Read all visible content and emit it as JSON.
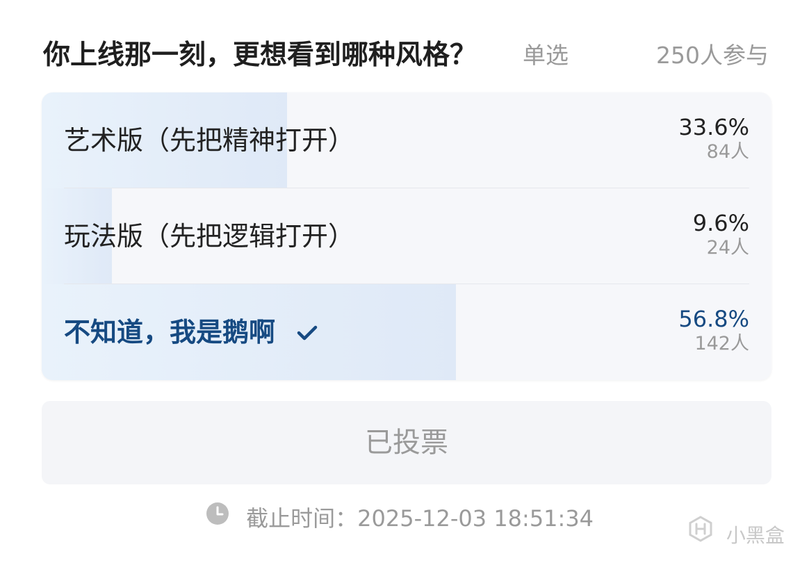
{
  "poll": {
    "question": "你上线那一刻，更想看到哪种风格？",
    "mode": "单选",
    "participants": "250人参与",
    "options": [
      {
        "label": "艺术版（先把精神打开）",
        "percent": "33.6%",
        "count": "84人",
        "ratio": 0.336,
        "selected": false
      },
      {
        "label": "玩法版（先把逻辑打开）",
        "percent": "9.6%",
        "count": "24人",
        "ratio": 0.096,
        "selected": false
      },
      {
        "label": "不知道，我是鹅啊",
        "percent": "56.8%",
        "count": "142人",
        "ratio": 0.568,
        "selected": true
      }
    ],
    "vote_button_label": "已投票",
    "deadline": "截止时间：2025-12-03 18:51:34"
  },
  "watermark": {
    "text": "小黑盒",
    "icon": "heybox-logo-icon"
  },
  "icons": {
    "selected": "check-icon",
    "deadline": "clock-icon"
  },
  "colors": {
    "selected_text": "#164a82",
    "bar_fill": "#dfe9f7",
    "muted_text": "#9a9a9a"
  }
}
